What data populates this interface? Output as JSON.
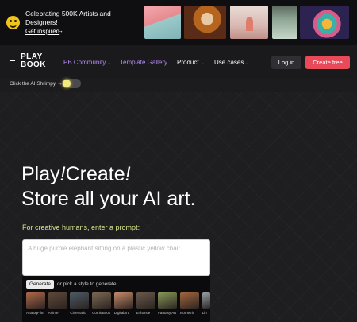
{
  "banner": {
    "message": "Celebrating 500K Artists and Designers!",
    "link_label": "Get inspired",
    "link_arrow": "→"
  },
  "nav": {
    "logo": "PLAY BOOK",
    "links": [
      {
        "label": "PB Community"
      },
      {
        "label": "Template Gallery"
      },
      {
        "label": "Product"
      },
      {
        "label": "Use cases"
      }
    ],
    "login_label": "Log in",
    "create_label": "Create free"
  },
  "shrimpy": {
    "label": "Click the AI Shrimpy →"
  },
  "hero": {
    "line1_a": "Play",
    "line1_b": "!",
    "line1_c": "Create",
    "line1_d": "!",
    "line2": "Store all your AI art.",
    "prompt_label": "For creative humans, enter a prompt:",
    "prompt_placeholder": "A huge purple elephant sitting on a plastic yellow chair...",
    "generate_label": "Generate",
    "style_hint": "or pick a style to generate",
    "styles": [
      {
        "name": "AnalogFilm",
        "color": "#b06a4a"
      },
      {
        "name": "Anime",
        "color": "#5f4a3a"
      },
      {
        "name": "Cinematic",
        "color": "#4e5b66"
      },
      {
        "name": "ComicBook",
        "color": "#7d6a55"
      },
      {
        "name": "DigitalArt",
        "color": "#c98d6b"
      },
      {
        "name": "Enhance",
        "color": "#6b5a4d"
      },
      {
        "name": "Fantasy Art",
        "color": "#8a9a5b"
      },
      {
        "name": "Isometric",
        "color": "#a5673f"
      },
      {
        "name": "Lin",
        "color": "#9aa3a8"
      }
    ]
  },
  "colors": {
    "accent_purple": "#b48bf2",
    "cta_red": "#e84a5a",
    "prompt_label_yellow": "#d6e58a"
  },
  "icons": [
    "smiley-icon",
    "menu-icon",
    "chevron-down-icon"
  ]
}
